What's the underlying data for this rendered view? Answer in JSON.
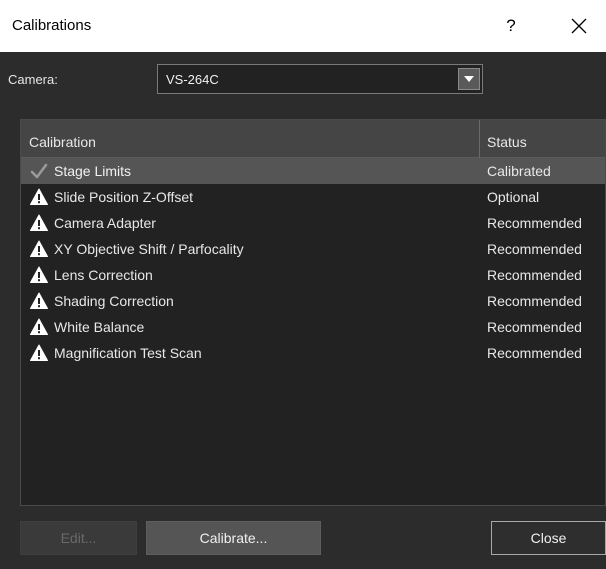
{
  "window": {
    "title": "Calibrations",
    "help_label": "?"
  },
  "camera": {
    "label": "Camera:",
    "selected": "VS-264C"
  },
  "table": {
    "headers": {
      "calibration": "Calibration",
      "status": "Status"
    },
    "rows": [
      {
        "name": "Stage Limits",
        "status": "Calibrated",
        "icon": "checkmark-icon",
        "selected": true
      },
      {
        "name": "Slide Position Z-Offset",
        "status": "Optional",
        "icon": "warning-icon",
        "selected": false
      },
      {
        "name": "Camera Adapter",
        "status": "Recommended",
        "icon": "warning-icon",
        "selected": false
      },
      {
        "name": "XY Objective Shift / Parfocality",
        "status": "Recommended",
        "icon": "warning-icon",
        "selected": false
      },
      {
        "name": "Lens Correction",
        "status": "Recommended",
        "icon": "warning-icon",
        "selected": false
      },
      {
        "name": "Shading Correction",
        "status": "Recommended",
        "icon": "warning-icon",
        "selected": false
      },
      {
        "name": "White Balance",
        "status": "Recommended",
        "icon": "warning-icon",
        "selected": false
      },
      {
        "name": "Magnification Test Scan",
        "status": "Recommended",
        "icon": "warning-icon",
        "selected": false
      }
    ]
  },
  "buttons": {
    "edit": "Edit...",
    "calibrate": "Calibrate...",
    "close": "Close"
  },
  "colors": {
    "background": "#2c2c2c",
    "list_background": "#222222",
    "header": "#454545",
    "selected_row": "#555555",
    "warning_fill": "#ffffff"
  }
}
